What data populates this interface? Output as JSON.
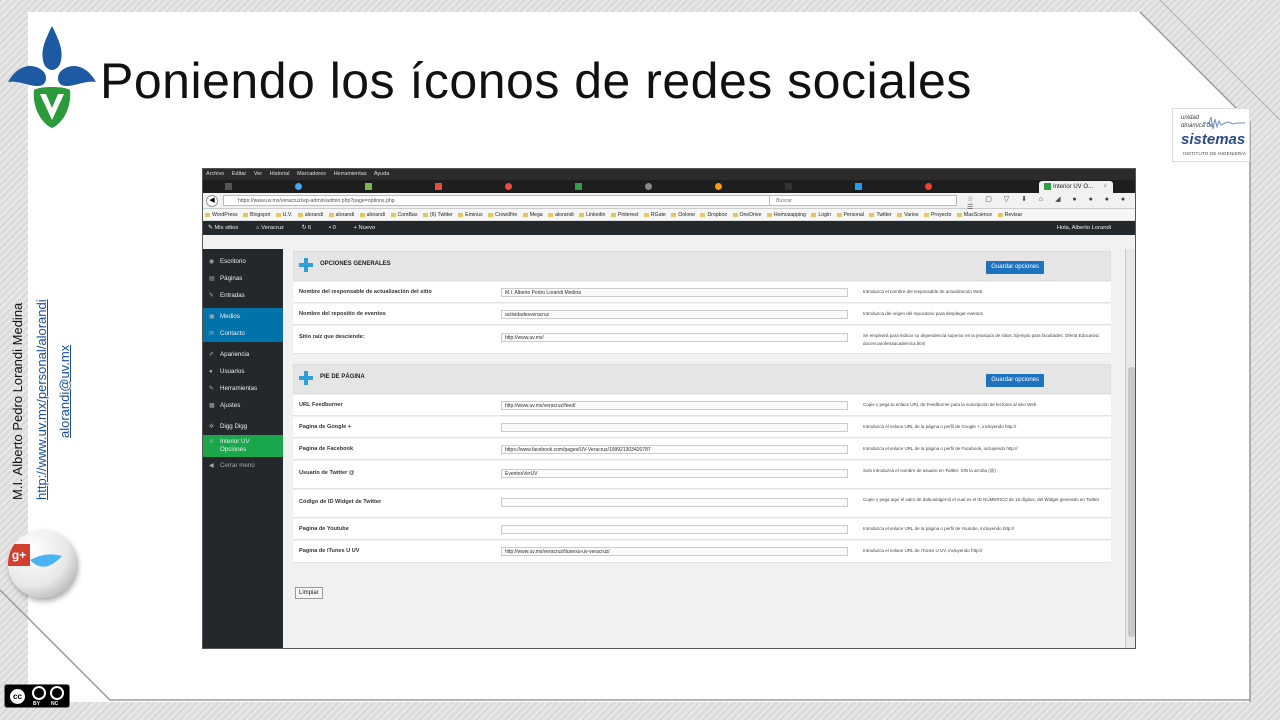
{
  "slide": {
    "title": "Poniendo los íconos de redes sociales",
    "author": "M.I. Alberto Pedro Lorandi Medina",
    "link_personal": "http://www.uv.mx/personal/alorandi",
    "link_email": "alorandi@uv.mx",
    "sistemas_logo": {
      "line1": "unidad",
      "line2": "dinámica de",
      "line3": "sistemas",
      "line4": "INSTITUTO DE INGENIERÍA"
    },
    "license": {
      "cc": "cc",
      "by": "BY",
      "nc": "NC"
    },
    "social_badge": "g+",
    "accent_blue": "#1a4e9c"
  },
  "browser": {
    "menu": [
      "Archivo",
      "Editar",
      "Ver",
      "Historial",
      "Marcadores",
      "Herramientas",
      "Ayuda"
    ],
    "active_tab": "Interior UV O...",
    "url": "https://www.uv.mx/veracruz/wp-admin/admin.php?page=options.php",
    "search_placeholder": "Buscar",
    "bookmarks": [
      "WordPress",
      "Blogspot",
      "U.V.",
      "alorandi",
      "alorandi",
      "alorandi",
      "ComBas",
      "(6) Twitter",
      "Eminus",
      "Crowdfire",
      "Mega",
      "alorandi",
      "Linkedin",
      "Pinterest",
      "RGate",
      "Oolone",
      "Dropbox",
      "OneDrive",
      "Homozapping",
      "Login",
      "Personal",
      "Twitter",
      "Varios",
      "Proyecto",
      "MasScience",
      "Revisar"
    ],
    "wpbar": {
      "mis_sitios": "Mis sitios",
      "site": "Veracruz",
      "updates": "6",
      "comments": "0",
      "nuevo": "Nuevo",
      "greeting": "Hola, Alberto Lorandi"
    }
  },
  "sidebar": {
    "items": [
      {
        "label": "Escritorio",
        "icon": "gauge-icon"
      },
      {
        "label": "Páginas",
        "icon": "pages-icon"
      },
      {
        "label": "Entradas",
        "icon": "pin-icon"
      },
      {
        "label": "Medios",
        "icon": "media-icon"
      },
      {
        "label": "Contacto",
        "icon": "mail-icon"
      },
      {
        "label": "Apariencia",
        "icon": "brush-icon"
      },
      {
        "label": "Usuarios",
        "icon": "user-icon"
      },
      {
        "label": "Herramientas",
        "icon": "wrench-icon"
      },
      {
        "label": "Ajustes",
        "icon": "settings-icon"
      },
      {
        "label": "Digg Digg",
        "icon": "gear-icon"
      },
      {
        "label": "Interior UV Opciones",
        "icon": "gear-icon"
      },
      {
        "label": "Cerrar menú",
        "icon": "collapse-icon"
      }
    ]
  },
  "options": {
    "general": {
      "title": "OPCIONES GENERALES",
      "save": "Guardar opciones",
      "rows": [
        {
          "label": "Nombre del responsable de actualización del sitio",
          "value": "M.I. Alberto Pedro Lorandi Medina",
          "desc": "Introduzca el nombre del responsable de actualización Web."
        },
        {
          "label": "Nombre del repositio de eventos",
          "value": "actividadesveracruz",
          "desc": "Introduzca del origen del repositorio para desplegar eventos"
        },
        {
          "label": "Sitio raíz que desciende:",
          "value": "http://www.uv.mx/",
          "desc": "Se empleará para indicar su dependencia superior en la jerarquía de sitios. Ejemplo para facultades: Oferta Educativa; docencia/ofertaacademica.html"
        }
      ]
    },
    "footer": {
      "title": "PIE DE PÁGINA",
      "save": "Guardar opciones",
      "rows": [
        {
          "label": "URL Feedburner",
          "value": "http://www.uv.mx/veracruz/feed/",
          "desc": "Copie y pega tu enlace URL de Feedburner para la suscripción de lectores al sitio Web"
        },
        {
          "label": "Pagina de Google +",
          "value": "",
          "desc": "Introduzca el enlace URL de la página o perfil de Google +, incluyendo http://"
        },
        {
          "label": "Pagina de Facebook",
          "value": "https://www.facebook.com/pages/UV-Veracruz/199921303420787",
          "desc": "Introduzca el enlace URL de la página o perfil de Facebook, incluyendo http://"
        },
        {
          "label": "Usuario de Twitter @",
          "value": "EventosVerUV",
          "desc": "Solo introduzca el nombre de usuario en Twitter. SIN la arroba (@)"
        },
        {
          "label": "Código de ID Widget de Twitter",
          "value": "",
          "desc": "Copie y pega aquí el valor de data-widget-id el cual es el ID NÚMERICO de 18 dígitos, del Widget generado en Twitter"
        },
        {
          "label": "Pagina de Youtube",
          "value": "",
          "desc": "Introduzca el enlace URL de la página o perfil de Youtube, incluyendo http://"
        },
        {
          "label": "Pagina de iTunes U UV",
          "value": "http://www.uv.mx/veracruz/itunesu-uv-veracruz/",
          "desc": "Introduzca el enlace URL de iTunes U UV, incluyendo http://"
        }
      ]
    },
    "reset": "Limpiar"
  }
}
